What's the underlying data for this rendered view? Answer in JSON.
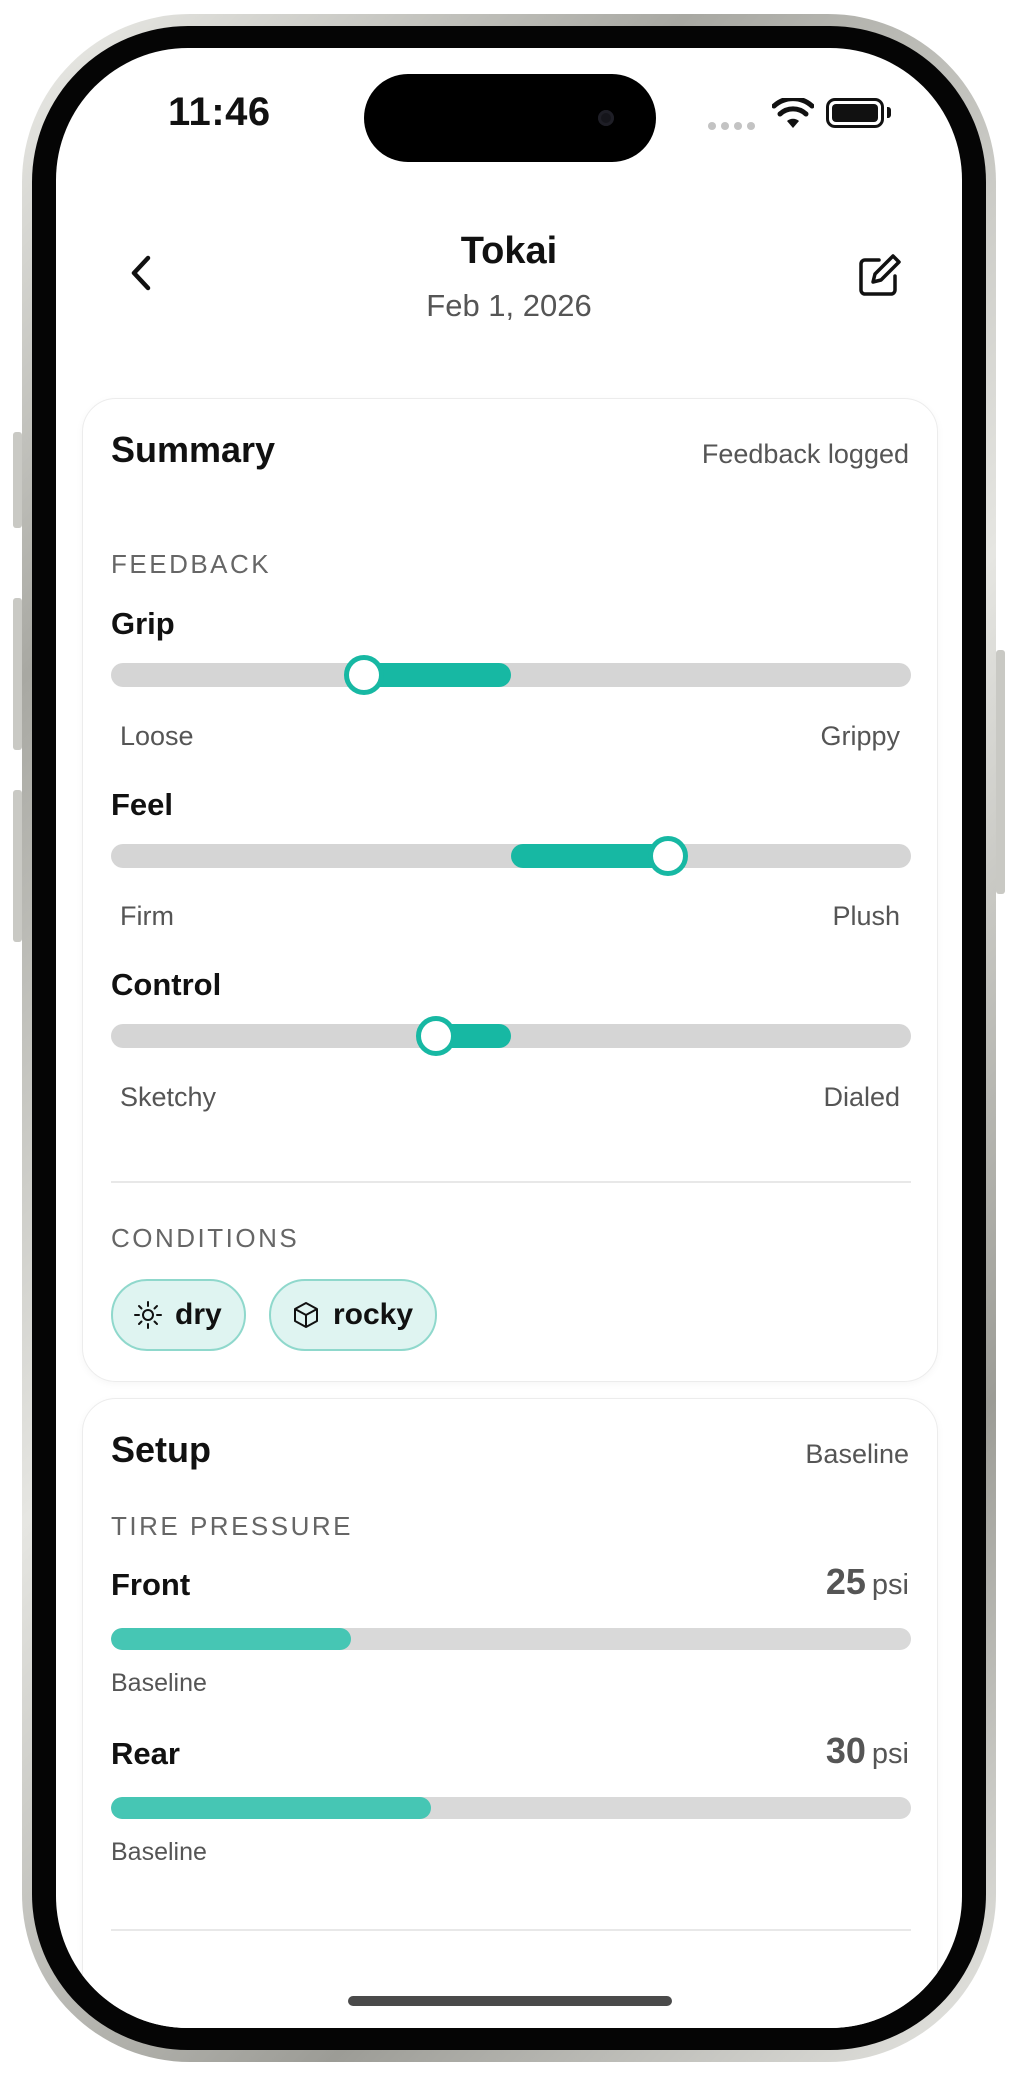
{
  "status_bar": {
    "time": "11:46"
  },
  "nav": {
    "title": "Tokai",
    "subtitle": "Feb 1, 2026"
  },
  "summary": {
    "title": "Summary",
    "meta": "Feedback logged",
    "feedback_label": "FEEDBACK",
    "sliders": [
      {
        "name": "Grip",
        "min_label": "Loose",
        "max_label": "Grippy",
        "value": 0.31
      },
      {
        "name": "Feel",
        "min_label": "Firm",
        "max_label": "Plush",
        "value": 0.69
      },
      {
        "name": "Control",
        "min_label": "Sketchy",
        "max_label": "Dialed",
        "value": 0.4
      }
    ],
    "conditions_label": "CONDITIONS",
    "conditions": [
      {
        "label": "dry",
        "icon": "sun-icon"
      },
      {
        "label": "rocky",
        "icon": "cube-icon"
      }
    ]
  },
  "setup": {
    "title": "Setup",
    "meta": "Baseline",
    "tire_pressure_label": "TIRE PRESSURE",
    "tires": [
      {
        "name": "Front",
        "value": "25",
        "unit": "psi",
        "caption": "Baseline",
        "fill_fraction": 0.3
      },
      {
        "name": "Rear",
        "value": "30",
        "unit": "psi",
        "caption": "Baseline",
        "fill_fraction": 0.4
      }
    ]
  },
  "colors": {
    "accent": "#17b8a3",
    "bar_fill": "#46c6b4",
    "chip_bg": "#dff4f1",
    "track": "#d5d5d5"
  }
}
